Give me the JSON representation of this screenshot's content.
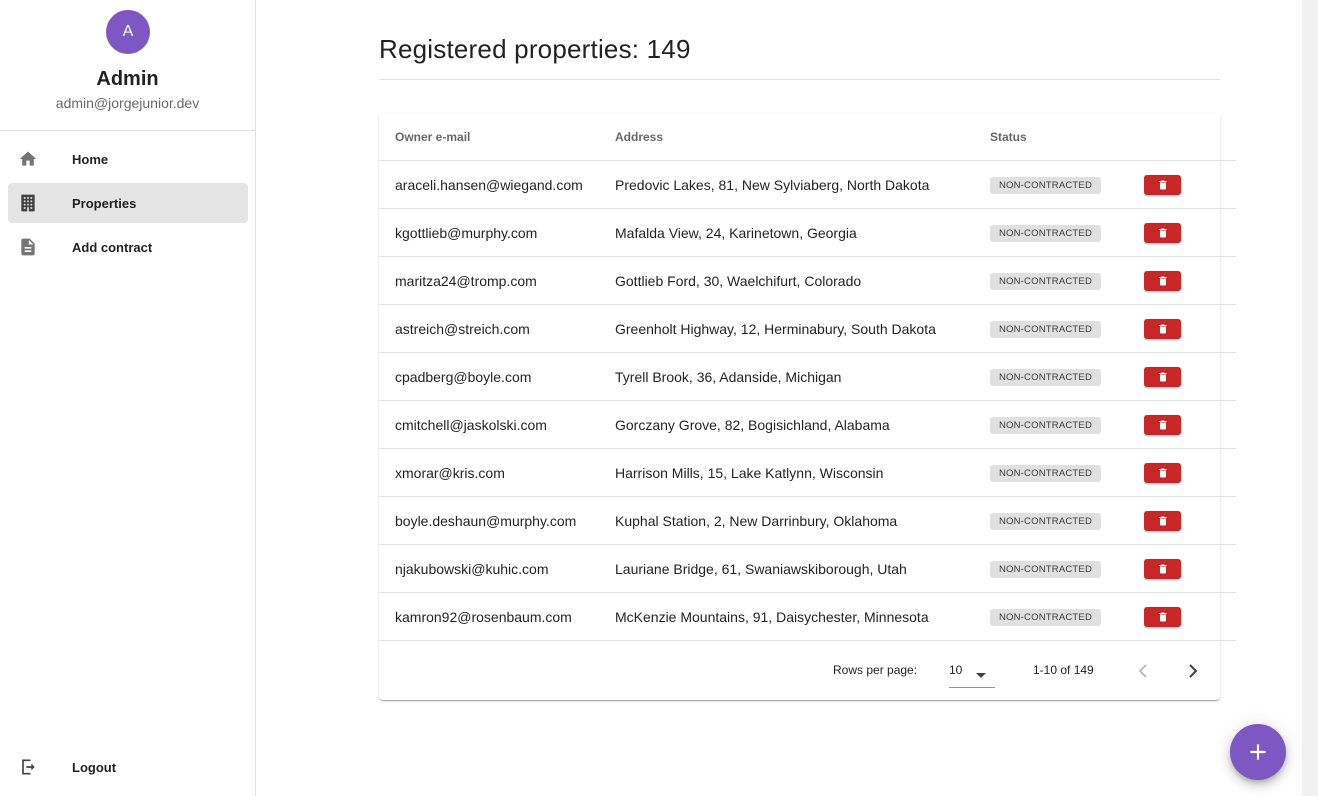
{
  "profile": {
    "avatar_letter": "A",
    "name": "Admin",
    "email": "admin@jorgejunior.dev"
  },
  "nav": {
    "items": [
      {
        "label": "Home",
        "icon": "home-icon"
      },
      {
        "label": "Properties",
        "icon": "building-icon",
        "active": true
      },
      {
        "label": "Add contract",
        "icon": "document-icon"
      }
    ],
    "logout_label": "Logout"
  },
  "main": {
    "title": "Registered properties: 149"
  },
  "table": {
    "headers": {
      "email": "Owner e-mail",
      "address": "Address",
      "status": "Status"
    },
    "rows": [
      {
        "email": "araceli.hansen@wiegand.com",
        "address": "Predovic Lakes, 81, New Sylviaberg, North Dakota",
        "status": "NON-CONTRACTED"
      },
      {
        "email": "kgottlieb@murphy.com",
        "address": "Mafalda View, 24, Karinetown, Georgia",
        "status": "NON-CONTRACTED"
      },
      {
        "email": "maritza24@tromp.com",
        "address": "Gottlieb Ford, 30, Waelchifurt, Colorado",
        "status": "NON-CONTRACTED"
      },
      {
        "email": "astreich@streich.com",
        "address": "Greenholt Highway, 12, Herminabury, South Dakota",
        "status": "NON-CONTRACTED"
      },
      {
        "email": "cpadberg@boyle.com",
        "address": "Tyrell Brook, 36, Adanside, Michigan",
        "status": "NON-CONTRACTED"
      },
      {
        "email": "cmitchell@jaskolski.com",
        "address": "Gorczany Grove, 82, Bogisichland, Alabama",
        "status": "NON-CONTRACTED"
      },
      {
        "email": "xmorar@kris.com",
        "address": "Harrison Mills, 15, Lake Katlynn, Wisconsin",
        "status": "NON-CONTRACTED"
      },
      {
        "email": "boyle.deshaun@murphy.com",
        "address": "Kuphal Station, 2, New Darrinbury, Oklahoma",
        "status": "NON-CONTRACTED"
      },
      {
        "email": "njakubowski@kuhic.com",
        "address": "Lauriane Bridge, 61, Swaniawskiborough, Utah",
        "status": "NON-CONTRACTED"
      },
      {
        "email": "kamron92@rosenbaum.com",
        "address": "McKenzie Mountains, 91, Daisychester, Minnesota",
        "status": "NON-CONTRACTED"
      }
    ]
  },
  "pagination": {
    "rows_per_page_label": "Rows per page:",
    "rows_per_page_value": "10",
    "range": "1-10 of 149"
  },
  "colors": {
    "accent": "#7e57c2",
    "delete": "#c62828"
  }
}
